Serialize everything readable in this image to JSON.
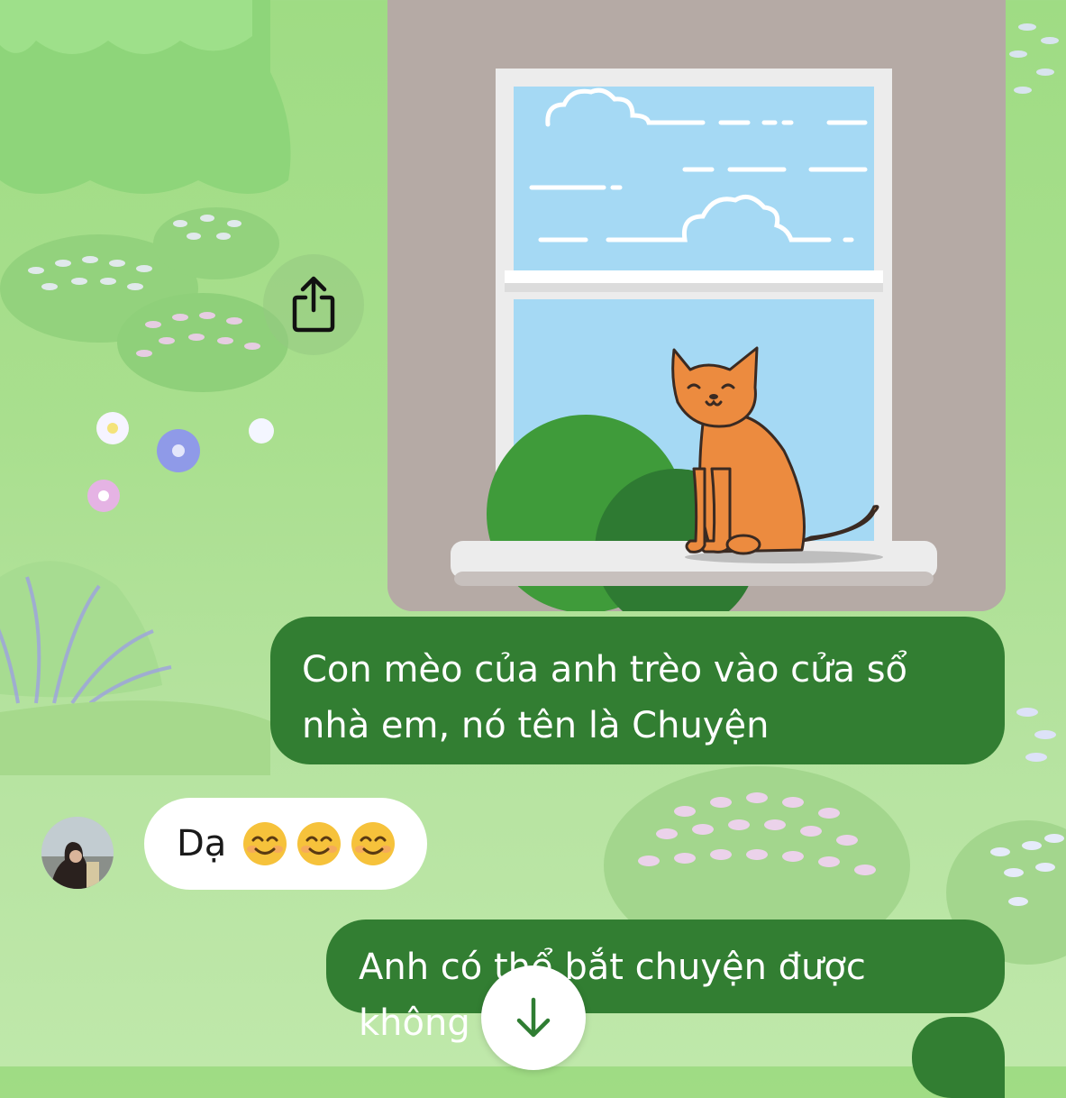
{
  "colors": {
    "outgoing_bubble": "#327e32",
    "incoming_bubble": "#ffffff",
    "background": "#a9df8e",
    "accent": "#327e32"
  },
  "image_message": {
    "icon": "share-icon"
  },
  "messages": [
    {
      "direction": "outgoing",
      "text": "Con mèo của anh trèo vào cửa sổ nhà em, nó tên là Chuyện"
    },
    {
      "direction": "incoming",
      "text": "Dạ",
      "emoji": [
        "smiling-face-emoji",
        "smiling-face-emoji",
        "smiling-face-emoji"
      ]
    },
    {
      "direction": "outgoing",
      "text": "Anh có thể bắt chuyện được không"
    },
    {
      "direction": "outgoing",
      "text": ""
    }
  ],
  "scroll_button": {
    "icon": "arrow-down-icon"
  }
}
